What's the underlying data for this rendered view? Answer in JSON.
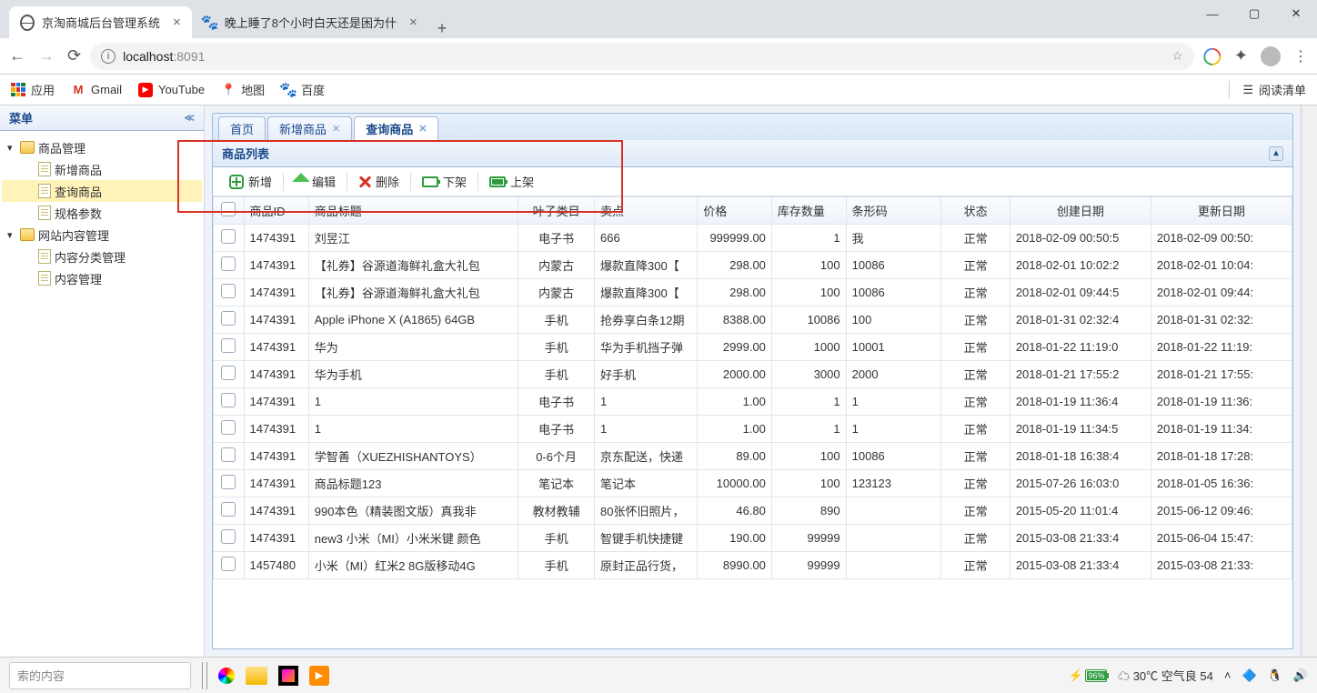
{
  "browser": {
    "tabs": [
      {
        "title": "京淘商城后台管理系统",
        "favicon": "globe"
      },
      {
        "title": "晚上睡了8个小时白天还是困为什",
        "favicon": "pawprint"
      }
    ],
    "url_host": "localhost",
    "url_port": ":8091",
    "bookmarks": {
      "apps": "应用",
      "gmail": "Gmail",
      "youtube": "YouTube",
      "maps": "地图",
      "baidu": "百度",
      "reading_list": "阅读清单"
    }
  },
  "sidebar": {
    "title": "菜单",
    "nodes": [
      {
        "label": "商品管理",
        "type": "folder"
      },
      {
        "label": "新增商品",
        "type": "doc"
      },
      {
        "label": "查询商品",
        "type": "doc"
      },
      {
        "label": "规格参数",
        "type": "doc"
      },
      {
        "label": "网站内容管理",
        "type": "folder"
      },
      {
        "label": "内容分类管理",
        "type": "doc"
      },
      {
        "label": "内容管理",
        "type": "doc"
      }
    ]
  },
  "app_tabs": [
    {
      "label": "首页",
      "closable": false
    },
    {
      "label": "新增商品",
      "closable": true
    },
    {
      "label": "查询商品",
      "closable": true
    }
  ],
  "panel": {
    "title": "商品列表",
    "toolbar": {
      "add": "新增",
      "edit": "编辑",
      "del": "删除",
      "down": "下架",
      "up": "上架"
    }
  },
  "grid": {
    "headers": [
      "商品ID",
      "商品标题",
      "叶子类目",
      "卖点",
      "价格",
      "库存数量",
      "条形码",
      "状态",
      "创建日期",
      "更新日期"
    ],
    "rows": [
      {
        "id": "1474391",
        "title": "刘昱江",
        "cat": "电子书",
        "point": "666",
        "price": "999999.00",
        "stock": "1",
        "barcode": "我",
        "status": "正常",
        "create": "2018-02-09 00:50:5",
        "update": "2018-02-09 00:50:"
      },
      {
        "id": "1474391",
        "title": "【礼券】谷源道海鲜礼盒大礼包",
        "cat": "内蒙古",
        "point": "爆款直降300【",
        "price": "298.00",
        "stock": "100",
        "barcode": "10086",
        "status": "正常",
        "create": "2018-02-01 10:02:2",
        "update": "2018-02-01 10:04:"
      },
      {
        "id": "1474391",
        "title": "【礼券】谷源道海鲜礼盒大礼包",
        "cat": "内蒙古",
        "point": "爆款直降300【",
        "price": "298.00",
        "stock": "100",
        "barcode": "10086",
        "status": "正常",
        "create": "2018-02-01 09:44:5",
        "update": "2018-02-01 09:44:"
      },
      {
        "id": "1474391",
        "title": "Apple iPhone X (A1865) 64GB",
        "cat": "手机",
        "point": "抢券享白条12期",
        "price": "8388.00",
        "stock": "10086",
        "barcode": "100",
        "status": "正常",
        "create": "2018-01-31 02:32:4",
        "update": "2018-01-31 02:32:"
      },
      {
        "id": "1474391",
        "title": "华为",
        "cat": "手机",
        "point": "华为手机挡子弹",
        "price": "2999.00",
        "stock": "1000",
        "barcode": "10001",
        "status": "正常",
        "create": "2018-01-22 11:19:0",
        "update": "2018-01-22 11:19:"
      },
      {
        "id": "1474391",
        "title": "华为手机",
        "cat": "手机",
        "point": "好手机",
        "price": "2000.00",
        "stock": "3000",
        "barcode": "2000",
        "status": "正常",
        "create": "2018-01-21 17:55:2",
        "update": "2018-01-21 17:55:"
      },
      {
        "id": "1474391",
        "title": "1",
        "cat": "电子书",
        "point": "1",
        "price": "1.00",
        "stock": "1",
        "barcode": "1",
        "status": "正常",
        "create": "2018-01-19 11:36:4",
        "update": "2018-01-19 11:36:"
      },
      {
        "id": "1474391",
        "title": "1",
        "cat": "电子书",
        "point": "1",
        "price": "1.00",
        "stock": "1",
        "barcode": "1",
        "status": "正常",
        "create": "2018-01-19 11:34:5",
        "update": "2018-01-19 11:34:"
      },
      {
        "id": "1474391",
        "title": "学智善（XUEZHISHANTOYS）",
        "cat": "0-6个月",
        "point": "京东配送，快递",
        "price": "89.00",
        "stock": "100",
        "barcode": "10086",
        "status": "正常",
        "create": "2018-01-18 16:38:4",
        "update": "2018-01-18 17:28:"
      },
      {
        "id": "1474391",
        "title": "商品标题123",
        "cat": "笔记本",
        "point": "笔记本",
        "price": "10000.00",
        "stock": "100",
        "barcode": "123123",
        "status": "正常",
        "create": "2015-07-26 16:03:0",
        "update": "2018-01-05 16:36:"
      },
      {
        "id": "1474391",
        "title": "990本色（精装图文版）真我非",
        "cat": "教材教辅",
        "point": "80张怀旧照片，",
        "price": "46.80",
        "stock": "890",
        "barcode": "",
        "status": "正常",
        "create": "2015-05-20 11:01:4",
        "update": "2015-06-12 09:46:"
      },
      {
        "id": "1474391",
        "title": "new3 小米（MI）小米米键 颜色",
        "cat": "手机",
        "point": "智键手机快捷键",
        "price": "190.00",
        "stock": "99999",
        "barcode": "",
        "status": "正常",
        "create": "2015-03-08 21:33:4",
        "update": "2015-06-04 15:47:"
      },
      {
        "id": "1457480",
        "title": "小米（MI）红米2 8G版移动4G",
        "cat": "手机",
        "point": "原封正品行货，",
        "price": "8990.00",
        "stock": "99999",
        "barcode": "",
        "status": "正常",
        "create": "2015-03-08 21:33:4",
        "update": "2015-03-08 21:33:"
      }
    ]
  },
  "taskbar": {
    "search_placeholder": "索的内容",
    "battery": "96%",
    "weather": "30℃ 空气良 54"
  }
}
